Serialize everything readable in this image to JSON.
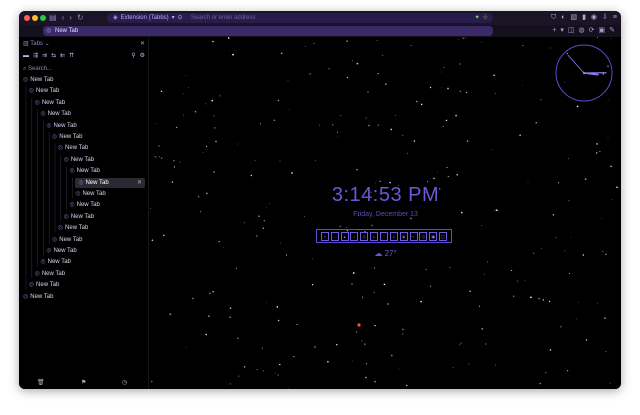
{
  "toolbar": {
    "url_tab_label": "Extension (Tabbs)",
    "url_placeholder": "Search or enter address"
  },
  "tabbar": {
    "active_tab_title": "New Tab"
  },
  "sidebar": {
    "title": "Tabs",
    "search_placeholder": "Search...",
    "tree": [
      {
        "label": "New Tab",
        "depth": 0
      },
      {
        "label": "New Tab",
        "depth": 1
      },
      {
        "label": "New Tab",
        "depth": 2
      },
      {
        "label": "New Tab",
        "depth": 3
      },
      {
        "label": "New Tab",
        "depth": 4
      },
      {
        "label": "New Tab",
        "depth": 5
      },
      {
        "label": "New Tab",
        "depth": 6
      },
      {
        "label": "New Tab",
        "depth": 7
      },
      {
        "label": "New Tab",
        "depth": 8
      },
      {
        "label": "New Tab",
        "depth": 9,
        "selected": true
      },
      {
        "label": "New Tab",
        "depth": 9
      },
      {
        "label": "New Tab",
        "depth": 8
      },
      {
        "label": "New Tab",
        "depth": 7
      },
      {
        "label": "New Tab",
        "depth": 6
      },
      {
        "label": "New Tab",
        "depth": 5
      },
      {
        "label": "New Tab",
        "depth": 4
      },
      {
        "label": "New Tab",
        "depth": 3
      },
      {
        "label": "New Tab",
        "depth": 2
      },
      {
        "label": "New Tab",
        "depth": 1
      },
      {
        "label": "New Tab",
        "depth": 0
      }
    ]
  },
  "newtab": {
    "time": "3:14:53 PM",
    "date": "Friday, December 13",
    "temperature": "27°"
  },
  "analog_clock": {
    "hour": 3,
    "minute": 14,
    "second": 53
  },
  "colors": {
    "accent": "#6a58d8",
    "background": "#000000"
  }
}
